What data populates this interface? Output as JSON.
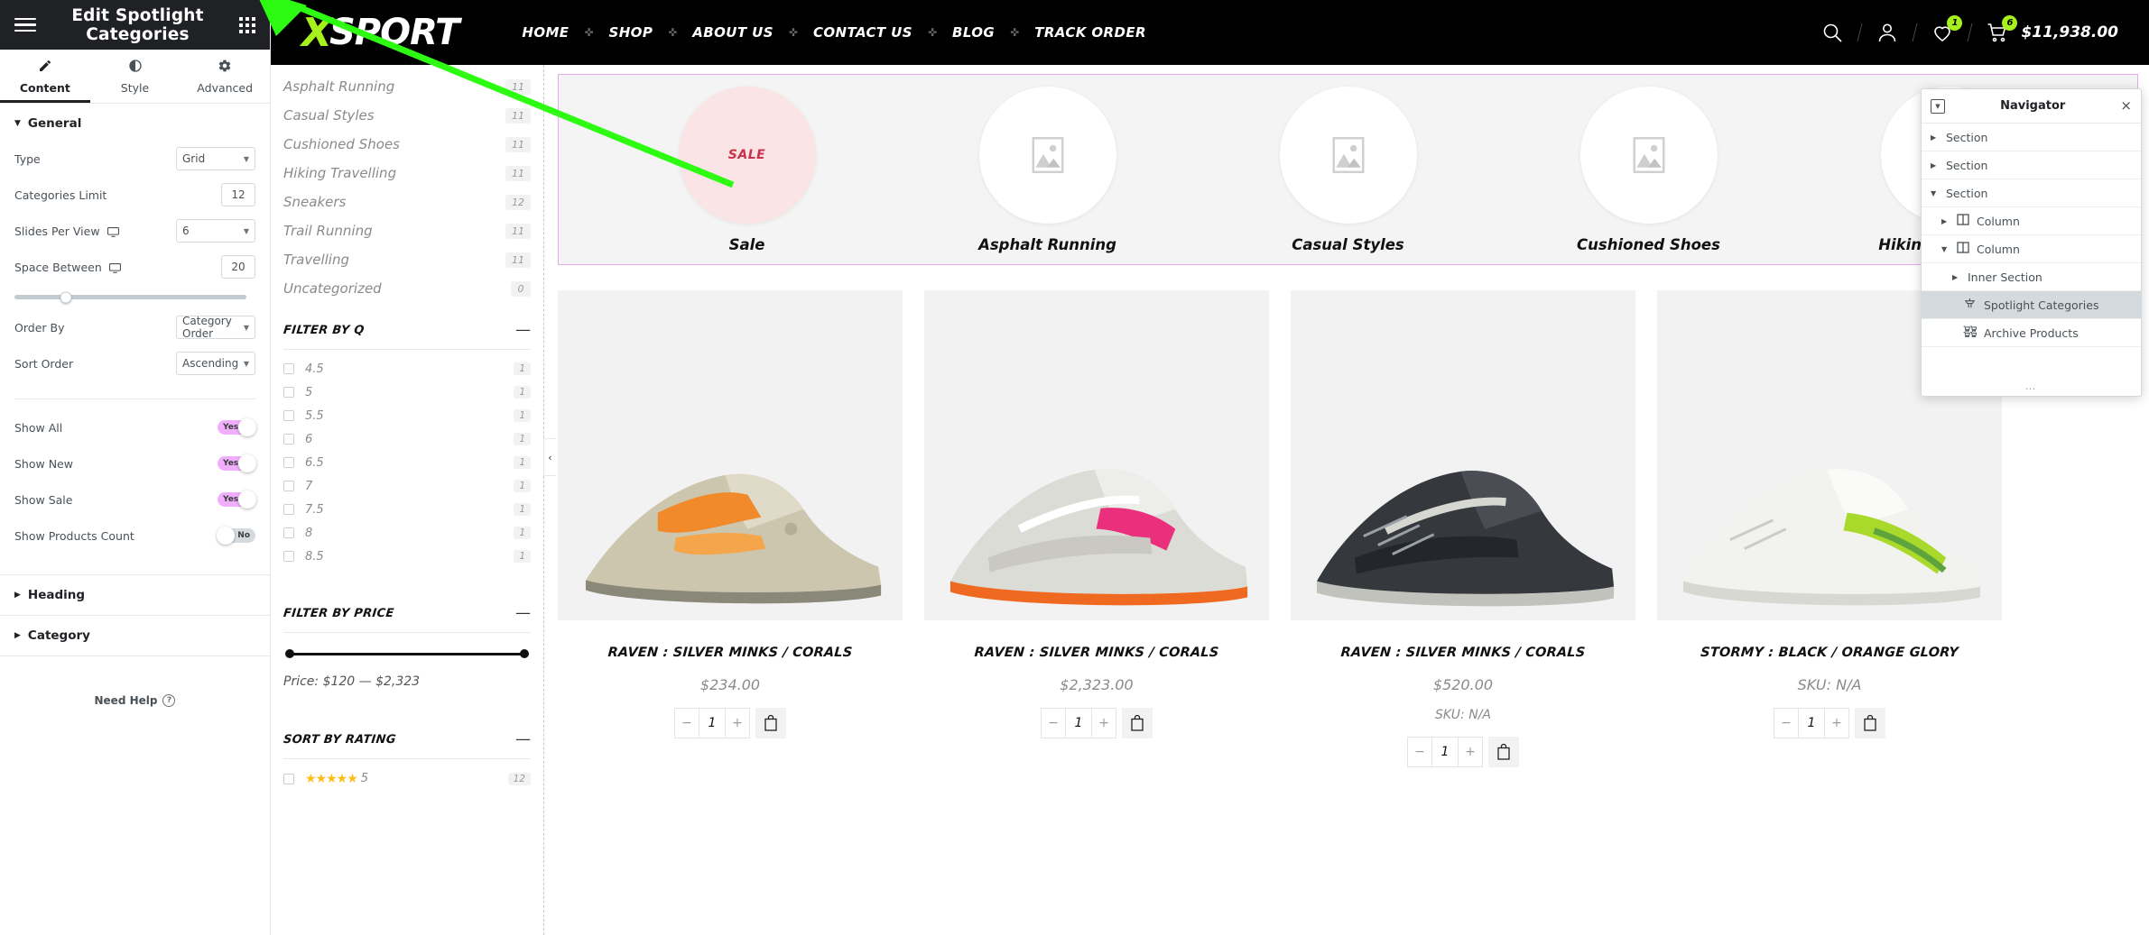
{
  "panel": {
    "title": "Edit Spotlight Categories",
    "menu_icon": "hamburger-icon",
    "apps_icon": "grid-apps-icon",
    "tabs": [
      {
        "label": "Content",
        "icon": "pencil-icon",
        "active": true
      },
      {
        "label": "Style",
        "icon": "contrast-icon",
        "active": false
      },
      {
        "label": "Advanced",
        "icon": "gear-icon",
        "active": false
      }
    ],
    "general": {
      "title": "General",
      "controls": [
        {
          "label": "Type",
          "type": "select",
          "value": "Grid"
        },
        {
          "label": "Categories Limit",
          "type": "number",
          "value": "12"
        },
        {
          "label": "Slides Per View",
          "type": "select",
          "value": "6",
          "responsive": "desktop-icon"
        },
        {
          "label": "Space Between",
          "type": "slider",
          "value": "20",
          "responsive": "desktop-icon"
        },
        {
          "label": "Order By",
          "type": "select",
          "value": "Category Order"
        },
        {
          "label": "Sort Order",
          "type": "select",
          "value": "Ascending"
        }
      ],
      "toggles": [
        {
          "label": "Show All",
          "value": "Yes",
          "on": true
        },
        {
          "label": "Show New",
          "value": "Yes",
          "on": true
        },
        {
          "label": "Show Sale",
          "value": "Yes",
          "on": true
        },
        {
          "label": "Show Products Count",
          "value": "No",
          "on": false
        }
      ]
    },
    "accordions": [
      {
        "label": "Heading"
      },
      {
        "label": "Category"
      }
    ],
    "need_help": "Need Help"
  },
  "site_header": {
    "logo_x": "X",
    "logo_text": "SPORT",
    "nav": [
      "HOME",
      "SHOP",
      "ABOUT US",
      "CONTACT US",
      "BLOG",
      "TRACK ORDER"
    ],
    "icons": {
      "search": "search-icon",
      "account": "user-icon",
      "wishlist": "heart-icon",
      "cart": "cart-icon"
    },
    "wishlist_count": "1",
    "cart_count": "6",
    "cart_total": "$11,938.00"
  },
  "shop_sidebar": {
    "categories": [
      {
        "name": "Asphalt Running",
        "count": "11"
      },
      {
        "name": "Casual Styles",
        "count": "11"
      },
      {
        "name": "Cushioned Shoes",
        "count": "11"
      },
      {
        "name": "Hiking Travelling",
        "count": "11"
      },
      {
        "name": "Sneakers",
        "count": "12"
      },
      {
        "name": "Trail Running",
        "count": "11"
      },
      {
        "name": "Travelling",
        "count": "11"
      },
      {
        "name": "Uncategorized",
        "count": "0"
      }
    ],
    "filter_q": {
      "title": "FILTER BY Q",
      "collapse": "—",
      "items": [
        {
          "name": "4.5",
          "count": "1"
        },
        {
          "name": "5",
          "count": "1"
        },
        {
          "name": "5.5",
          "count": "1"
        },
        {
          "name": "6",
          "count": "1"
        },
        {
          "name": "6.5",
          "count": "1"
        },
        {
          "name": "7",
          "count": "1"
        },
        {
          "name": "7.5",
          "count": "1"
        },
        {
          "name": "8",
          "count": "1"
        },
        {
          "name": "8.5",
          "count": "1"
        }
      ]
    },
    "filter_price": {
      "title": "FILTER BY PRICE",
      "collapse": "—",
      "price_text": "Price: $120 — $2,323"
    },
    "sort_rating": {
      "title": "SORT BY RATING",
      "collapse": "—",
      "items": [
        {
          "stars": "★★★★★",
          "label": "5",
          "count": "12"
        }
      ]
    }
  },
  "spotlight": {
    "items": [
      {
        "label": "Sale",
        "type": "sale",
        "badge": "SALE"
      },
      {
        "label": "Asphalt Running",
        "type": "placeholder"
      },
      {
        "label": "Casual Styles",
        "type": "placeholder"
      },
      {
        "label": "Cushioned Shoes",
        "type": "placeholder"
      },
      {
        "label": "Hiking Travelling",
        "type": "placeholder"
      }
    ]
  },
  "products": [
    {
      "title": "RAVEN : SILVER MINKS / CORALS",
      "price": "$234.00",
      "sku": "",
      "qty": "1"
    },
    {
      "title": "RAVEN : SILVER MINKS / CORALS",
      "price": "$2,323.00",
      "sku": "",
      "qty": "1"
    },
    {
      "title": "RAVEN : SILVER MINKS / CORALS",
      "price": "$520.00",
      "sku": "SKU: N/A",
      "qty": "1"
    },
    {
      "title": "STORMY : BLACK / ORANGE GLORY",
      "price": "SKU: N/A",
      "sku": "",
      "qty": "1"
    }
  ],
  "navigator": {
    "title": "Navigator",
    "dock_icon": "dock-icon",
    "close_icon": "close-icon",
    "items": [
      {
        "label": "Section",
        "depth": 0,
        "expanded": false,
        "icon": ""
      },
      {
        "label": "Section",
        "depth": 0,
        "expanded": false,
        "icon": ""
      },
      {
        "label": "Section",
        "depth": 0,
        "expanded": true,
        "icon": ""
      },
      {
        "label": "Column",
        "depth": 1,
        "expanded": false,
        "icon": "column-icon"
      },
      {
        "label": "Column",
        "depth": 1,
        "expanded": true,
        "icon": "column-icon"
      },
      {
        "label": "Inner Section",
        "depth": 2,
        "expanded": false,
        "icon": ""
      },
      {
        "label": "Spotlight Categories",
        "depth": 3,
        "expanded": null,
        "icon": "spotlight-icon",
        "selected": true
      },
      {
        "label": "Archive Products",
        "depth": 3,
        "expanded": null,
        "icon": "products-icon"
      }
    ],
    "footer": "…"
  },
  "colors": {
    "accent_pink": "#f0aefc",
    "brand_green": "#a6f01c",
    "panel_dark": "#1f2124",
    "highlight_border": "#e8a7f0",
    "pointer_green": "#2dfb12"
  }
}
